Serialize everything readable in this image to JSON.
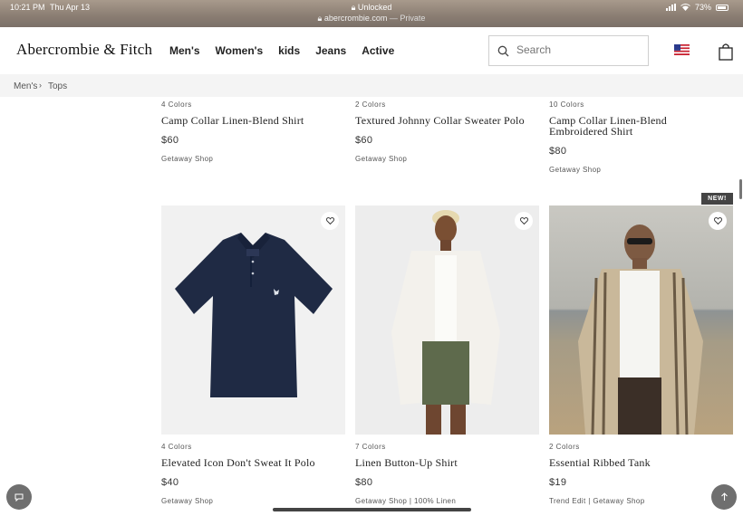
{
  "status_bar": {
    "time": "10:21 PM",
    "date": "Thu Apr 13",
    "tab_title": "Unlocked",
    "url": "abercrombie.com",
    "private_label": "Private",
    "battery": "73%"
  },
  "header": {
    "logo": "Abercrombie & Fitch",
    "nav": [
      "Men's",
      "Women's",
      "kids",
      "Jeans",
      "Active"
    ],
    "search_placeholder": "Search"
  },
  "breadcrumb": [
    "Men's",
    "Tops"
  ],
  "products_top": [
    {
      "colors": "4 Colors",
      "name": "Camp Collar Linen-Blend Shirt",
      "price": "$60",
      "shop": "Getaway Shop"
    },
    {
      "colors": "2 Colors",
      "name": "Textured Johnny Collar Sweater Polo",
      "price": "$60",
      "shop": "Getaway Shop"
    },
    {
      "colors": "10 Colors",
      "name": "Camp Collar Linen-Blend Embroidered Shirt",
      "price": "$80",
      "shop": "Getaway Shop"
    }
  ],
  "products_bottom": [
    {
      "colors": "4 Colors",
      "name": "Elevated Icon Don't Sweat It Polo",
      "price": "$40",
      "shop": "Getaway Shop"
    },
    {
      "colors": "7 Colors",
      "name": "Linen Button-Up Shirt",
      "price": "$80",
      "shop": "Getaway Shop | 100% Linen"
    },
    {
      "colors": "2 Colors",
      "name": "Essential Ribbed Tank",
      "price": "$19",
      "shop": "Trend Edit | Getaway Shop"
    }
  ],
  "new_badge": "NEW!",
  "colors": {
    "polo_navy": "#1f2a44",
    "linen_white": "#f3f1ec",
    "shorts_olive": "#5e6a4c",
    "beach_sand": "#b9a27e"
  }
}
